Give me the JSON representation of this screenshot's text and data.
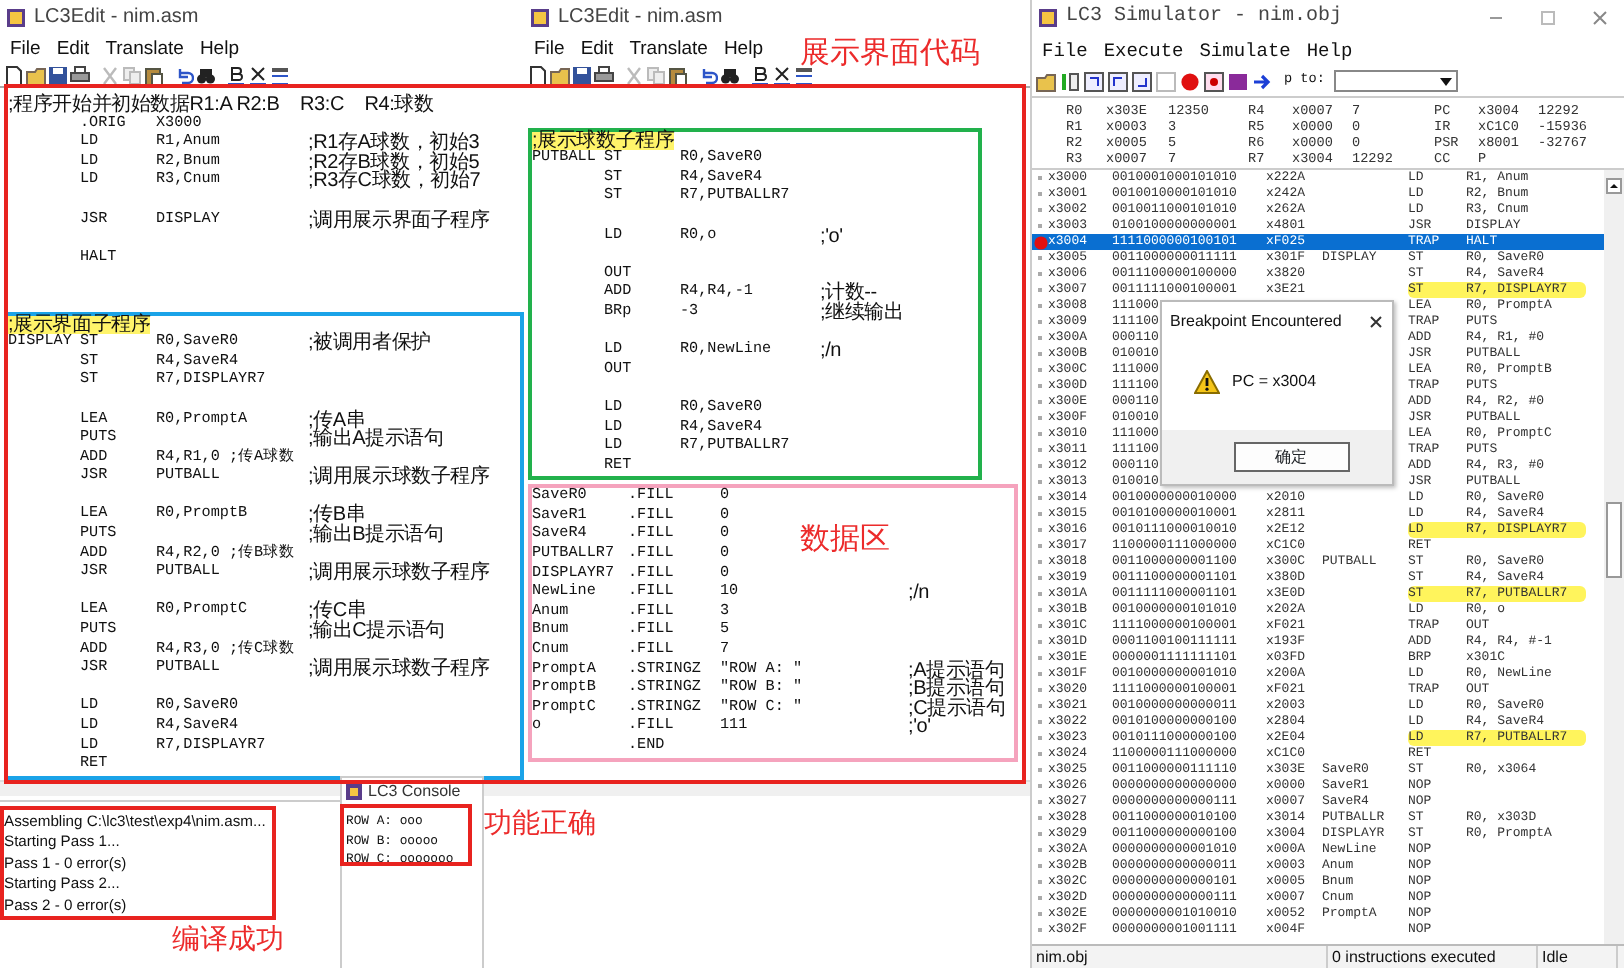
{
  "editors": [
    {
      "title": "LC3Edit - nim.asm",
      "menu": [
        "File",
        "Edit",
        "Translate",
        "Help"
      ],
      "blocks": [
        {
          "lines": [
            {
              "kind": "comment",
              "text": ";程序开始并初始数据R1:A R2:B    R3:C    R4:球数",
              "highlighted": false
            },
            {
              "kind": "code",
              "op": ".ORIG",
              "args": "X3000"
            },
            {
              "kind": "code",
              "op": "LD",
              "args": "R1,Anum",
              "comment": ";R1存A球数，初始3"
            },
            {
              "kind": "code",
              "op": "LD",
              "args": "R2,Bnum",
              "comment": ";R2存B球数，初始5"
            },
            {
              "kind": "code",
              "op": "LD",
              "args": "R3,Cnum",
              "comment": ";R3存C球数，初始7"
            },
            {
              "kind": "blank"
            },
            {
              "kind": "code",
              "op": "JSR",
              "args": "DISPLAY",
              "comment": ";调用展示界面子程序"
            },
            {
              "kind": "blank"
            },
            {
              "kind": "code",
              "op": "HALT"
            },
            {
              "kind": "blank"
            },
            {
              "kind": "blank"
            }
          ]
        },
        {
          "color": "#1aa3e8",
          "lines": [
            {
              "kind": "comment",
              "text": ";展示界面子程序",
              "highlighted": true
            },
            {
              "kind": "code",
              "label": "DISPLAY",
              "op": "ST",
              "args": "R0,SaveR0",
              "comment": ";被调用者保护"
            },
            {
              "kind": "code",
              "op": "ST",
              "args": "R4,SaveR4"
            },
            {
              "kind": "code",
              "op": "ST",
              "args": "R7,DISPLAYR7"
            },
            {
              "kind": "blank"
            },
            {
              "kind": "code",
              "op": "LEA",
              "args": "R0,PromptA",
              "comment": ";传A串"
            },
            {
              "kind": "code",
              "op": "PUTS",
              "comment": ";输出A提示语句"
            },
            {
              "kind": "code",
              "op": "ADD",
              "args": "R4,R1,0 ;传A球数"
            },
            {
              "kind": "code",
              "op": "JSR",
              "args": "PUTBALL",
              "comment": ";调用展示球数子程序"
            },
            {
              "kind": "blank"
            },
            {
              "kind": "code",
              "op": "LEA",
              "args": "R0,PromptB",
              "comment": ";传B串"
            },
            {
              "kind": "code",
              "op": "PUTS",
              "comment": ";输出B提示语句"
            },
            {
              "kind": "code",
              "op": "ADD",
              "args": "R4,R2,0 ;传B球数"
            },
            {
              "kind": "code",
              "op": "JSR",
              "args": "PUTBALL",
              "comment": ";调用展示球数子程序"
            },
            {
              "kind": "blank"
            },
            {
              "kind": "code",
              "op": "LEA",
              "args": "R0,PromptC",
              "comment": ";传C串"
            },
            {
              "kind": "code",
              "op": "PUTS",
              "comment": ";输出C提示语句"
            },
            {
              "kind": "code",
              "op": "ADD",
              "args": "R4,R3,0 ;传C球数"
            },
            {
              "kind": "code",
              "op": "JSR",
              "args": "PUTBALL",
              "comment": ";调用展示球数子程序"
            },
            {
              "kind": "blank"
            },
            {
              "kind": "code",
              "op": "LD",
              "args": "R0,SaveR0"
            },
            {
              "kind": "code",
              "op": "LD",
              "args": "R4,SaveR4"
            },
            {
              "kind": "code",
              "op": "LD",
              "args": "R7,DISPLAYR7"
            },
            {
              "kind": "code",
              "op": "RET"
            }
          ]
        }
      ]
    },
    {
      "title": "LC3Edit - nim.asm",
      "menu": [
        "File",
        "Edit",
        "Translate",
        "Help"
      ],
      "blocks": [
        {
          "lines": [
            {
              "kind": "blank"
            }
          ]
        },
        {
          "color": "#22b14c",
          "lines": [
            {
              "kind": "comment",
              "text": ";展示球数子程序",
              "highlighted": true
            },
            {
              "kind": "code",
              "label": "PUTBALL",
              "op": "ST",
              "args": "R0,SaveR0"
            },
            {
              "kind": "code",
              "op": "ST",
              "args": "R4,SaveR4"
            },
            {
              "kind": "code",
              "op": "ST",
              "args": "R7,PUTBALLR7"
            },
            {
              "kind": "blank"
            },
            {
              "kind": "code",
              "op": "LD",
              "args": "R0,o",
              "comment": ";'o'"
            },
            {
              "kind": "blank"
            },
            {
              "kind": "code",
              "op": "OUT"
            },
            {
              "kind": "code",
              "op": "ADD",
              "args": "R4,R4,-1",
              "comment": ";计数--"
            },
            {
              "kind": "code",
              "op": "BRp",
              "args": "-3",
              "comment": ";继续输出"
            },
            {
              "kind": "blank"
            },
            {
              "kind": "code",
              "op": "LD",
              "args": "R0,NewLine",
              "comment": ";/n"
            },
            {
              "kind": "code",
              "op": "OUT"
            },
            {
              "kind": "blank"
            },
            {
              "kind": "code",
              "op": "LD",
              "args": "R0,SaveR0"
            },
            {
              "kind": "code",
              "op": "LD",
              "args": "R4,SaveR4"
            },
            {
              "kind": "code",
              "op": "LD",
              "args": "R7,PUTBALLR7"
            },
            {
              "kind": "code",
              "op": "RET"
            }
          ]
        },
        {
          "color": "#f5a3bd",
          "lines": [
            {
              "kind": "code",
              "label": "SaveR0",
              "op": ".FILL",
              "args": "0"
            },
            {
              "kind": "code",
              "label": "SaveR1",
              "op": ".FILL",
              "args": "0"
            },
            {
              "kind": "code",
              "label": "SaveR4",
              "op": ".FILL",
              "args": "0"
            },
            {
              "kind": "code",
              "label": "PUTBALLR7",
              "op": ".FILL",
              "args": "0"
            },
            {
              "kind": "code",
              "label": "DISPLAYR7",
              "op": ".FILL",
              "args": "0"
            },
            {
              "kind": "code",
              "label": "NewLine",
              "op": ".FILL",
              "args": "10",
              "comment": ";/n"
            },
            {
              "kind": "code",
              "label": "Anum",
              "op": ".FILL",
              "args": "3"
            },
            {
              "kind": "code",
              "label": "Bnum",
              "op": ".FILL",
              "args": "5"
            },
            {
              "kind": "code",
              "label": "Cnum",
              "op": ".FILL",
              "args": "7"
            },
            {
              "kind": "code",
              "label": "PromptA",
              "op": ".STRINGZ",
              "args": "\"ROW A: \"",
              "comment": ";A提示语句"
            },
            {
              "kind": "code",
              "label": "PromptB",
              "op": ".STRINGZ",
              "args": "\"ROW B: \"",
              "comment": ";B提示语句"
            },
            {
              "kind": "code",
              "label": "PromptC",
              "op": ".STRINGZ",
              "args": "\"ROW C: \"",
              "comment": ";C提示语句"
            },
            {
              "kind": "code",
              "label": "o",
              "op": ".FILL",
              "args": "111",
              "comment": ";'o'"
            },
            {
              "kind": "code",
              "op": ".END"
            }
          ]
        }
      ]
    }
  ],
  "simulator": {
    "title": "LC3 Simulator - nim.obj",
    "menu": [
      "File",
      "Execute",
      "Simulate",
      "Help"
    ],
    "jump_label": "p to:",
    "register_rows": [
      {
        "cells": [
          {
            "name": "R0",
            "hex": "x303E",
            "value": "12350"
          },
          {
            "name": "R4",
            "hex": "x0007",
            "value": "7"
          },
          {
            "name": "PC",
            "hex": "x3004",
            "value": "12292"
          }
        ]
      },
      {
        "cells": [
          {
            "name": "R1",
            "hex": "x0003",
            "value": "3"
          },
          {
            "name": "R5",
            "hex": "x0000",
            "value": "0"
          },
          {
            "name": "IR",
            "hex": "xC1C0",
            "value": "-15936"
          }
        ]
      },
      {
        "cells": [
          {
            "name": "R2",
            "hex": "x0005",
            "value": "5"
          },
          {
            "name": "R6",
            "hex": "x0000",
            "value": "0"
          },
          {
            "name": "PSR",
            "hex": "x8001",
            "value": "-32767"
          }
        ]
      },
      {
        "cells": [
          {
            "name": "R3",
            "hex": "x0007",
            "value": "7"
          },
          {
            "name": "R7",
            "hex": "x3004",
            "value": "12292"
          },
          {
            "name": "CC",
            "hex": "P"
          }
        ]
      }
    ],
    "memory": [
      {
        "addr": "x3000",
        "bin": "0010001000101010",
        "hex": "x222A",
        "op": "LD",
        "operands": "R1, Anum",
        "breakpoint": false,
        "selected": false,
        "highlighted": false
      },
      {
        "addr": "x3001",
        "bin": "0010010000101010",
        "hex": "x242A",
        "op": "LD",
        "operands": "R2, Bnum",
        "breakpoint": false,
        "selected": false,
        "highlighted": false
      },
      {
        "addr": "x3002",
        "bin": "0010011000101010",
        "hex": "x262A",
        "op": "LD",
        "operands": "R3, Cnum",
        "breakpoint": false,
        "selected": false,
        "highlighted": false
      },
      {
        "addr": "x3003",
        "bin": "0100100000000001",
        "hex": "x4801",
        "op": "JSR",
        "operands": "DISPLAY",
        "breakpoint": false,
        "selected": false,
        "highlighted": false
      },
      {
        "addr": "x3004",
        "bin": "1111000000100101",
        "hex": "xF025",
        "op": "TRAP",
        "operands": "HALT",
        "breakpoint": true,
        "selected": true,
        "highlighted": false
      },
      {
        "addr": "x3005",
        "bin": "0011000000011111",
        "hex": "x301F",
        "label": "DISPLAY",
        "op": "ST",
        "operands": "R0, SaveR0",
        "breakpoint": false,
        "selected": false,
        "highlighted": false
      },
      {
        "addr": "x3006",
        "bin": "0011100000100000",
        "hex": "x3820",
        "op": "ST",
        "operands": "R4, SaveR4",
        "breakpoint": false,
        "selected": false,
        "highlighted": false
      },
      {
        "addr": "x3007",
        "bin": "0011111000100001",
        "hex": "x3E21",
        "op": "ST",
        "operands": "R7, DISPLAYR7",
        "breakpoint": false,
        "selected": false,
        "highlighted": true
      },
      {
        "addr": "x3008",
        "bin": "111000",
        "op": "LEA",
        "operands": "R0, PromptA",
        "breakpoint": false,
        "selected": false,
        "highlighted": false
      },
      {
        "addr": "x3009",
        "bin": "111100",
        "op": "TRAP",
        "operands": "PUTS",
        "breakpoint": false,
        "selected": false,
        "highlighted": false
      },
      {
        "addr": "x300A",
        "bin": "000110",
        "op": "ADD",
        "operands": "R4, R1, #0",
        "breakpoint": false,
        "selected": false,
        "highlighted": false
      },
      {
        "addr": "x300B",
        "bin": "010010",
        "op": "JSR",
        "operands": "PUTBALL",
        "breakpoint": false,
        "selected": false,
        "highlighted": false
      },
      {
        "addr": "x300C",
        "bin": "111000",
        "op": "LEA",
        "operands": "R0, PromptB",
        "breakpoint": false,
        "selected": false,
        "highlighted": false
      },
      {
        "addr": "x300D",
        "bin": "111100",
        "op": "TRAP",
        "operands": "PUTS",
        "breakpoint": false,
        "selected": false,
        "highlighted": false
      },
      {
        "addr": "x300E",
        "bin": "000110",
        "op": "ADD",
        "operands": "R4, R2, #0",
        "breakpoint": false,
        "selected": false,
        "highlighted": false
      },
      {
        "addr": "x300F",
        "bin": "010010",
        "op": "JSR",
        "operands": "PUTBALL",
        "breakpoint": false,
        "selected": false,
        "highlighted": false
      },
      {
        "addr": "x3010",
        "bin": "111000",
        "op": "LEA",
        "operands": "R0, PromptC",
        "breakpoint": false,
        "selected": false,
        "highlighted": false
      },
      {
        "addr": "x3011",
        "bin": "111100",
        "op": "TRAP",
        "operands": "PUTS",
        "breakpoint": false,
        "selected": false,
        "highlighted": false
      },
      {
        "addr": "x3012",
        "bin": "000110",
        "op": "ADD",
        "operands": "R4, R3, #0",
        "breakpoint": false,
        "selected": false,
        "highlighted": false
      },
      {
        "addr": "x3013",
        "bin": "010010",
        "op": "JSR",
        "operands": "PUTBALL",
        "breakpoint": false,
        "selected": false,
        "highlighted": false
      },
      {
        "addr": "x3014",
        "bin": "0010000000010000",
        "hex": "x2010",
        "op": "LD",
        "operands": "R0, SaveR0",
        "breakpoint": false,
        "selected": false,
        "highlighted": false
      },
      {
        "addr": "x3015",
        "bin": "0010100000010001",
        "hex": "x2811",
        "op": "LD",
        "operands": "R4, SaveR4",
        "breakpoint": false,
        "selected": false,
        "highlighted": false
      },
      {
        "addr": "x3016",
        "bin": "0010111000010010",
        "hex": "x2E12",
        "op": "LD",
        "operands": "R7, DISPLAYR7",
        "breakpoint": false,
        "selected": false,
        "highlighted": true
      },
      {
        "addr": "x3017",
        "bin": "1100000111000000",
        "hex": "xC1C0",
        "op": "RET",
        "breakpoint": false,
        "selected": false,
        "highlighted": false
      },
      {
        "addr": "x3018",
        "bin": "0011000000001100",
        "hex": "x300C",
        "label": "PUTBALL",
        "op": "ST",
        "operands": "R0, SaveR0",
        "breakpoint": false,
        "selected": false,
        "highlighted": false
      },
      {
        "addr": "x3019",
        "bin": "0011100000001101",
        "hex": "x380D",
        "op": "ST",
        "operands": "R4, SaveR4",
        "breakpoint": false,
        "selected": false,
        "highlighted": false
      },
      {
        "addr": "x301A",
        "bin": "0011111000001101",
        "hex": "x3E0D",
        "op": "ST",
        "operands": "R7, PUTBALLR7",
        "breakpoint": false,
        "selected": false,
        "highlighted": true
      },
      {
        "addr": "x301B",
        "bin": "0010000000101010",
        "hex": "x202A",
        "op": "LD",
        "operands": "R0, o",
        "breakpoint": false,
        "selected": false,
        "highlighted": false
      },
      {
        "addr": "x301C",
        "bin": "1111000000100001",
        "hex": "xF021",
        "op": "TRAP",
        "operands": "OUT",
        "breakpoint": false,
        "selected": false,
        "highlighted": false
      },
      {
        "addr": "x301D",
        "bin": "0001100100111111",
        "hex": "x193F",
        "op": "ADD",
        "operands": "R4, R4, #-1",
        "breakpoint": false,
        "selected": false,
        "highlighted": false
      },
      {
        "addr": "x301E",
        "bin": "0000001111111101",
        "hex": "x03FD",
        "op": "BRP",
        "operands": "x301C",
        "breakpoint": false,
        "selected": false,
        "highlighted": false
      },
      {
        "addr": "x301F",
        "bin": "0010000000001010",
        "hex": "x200A",
        "op": "LD",
        "operands": "R0, NewLine",
        "breakpoint": false,
        "selected": false,
        "highlighted": false
      },
      {
        "addr": "x3020",
        "bin": "1111000000100001",
        "hex": "xF021",
        "op": "TRAP",
        "operands": "OUT",
        "breakpoint": false,
        "selected": false,
        "highlighted": false
      },
      {
        "addr": "x3021",
        "bin": "0010000000000011",
        "hex": "x2003",
        "op": "LD",
        "operands": "R0, SaveR0",
        "breakpoint": false,
        "selected": false,
        "highlighted": false
      },
      {
        "addr": "x3022",
        "bin": "0010100000000100",
        "hex": "x2804",
        "op": "LD",
        "operands": "R4, SaveR4",
        "breakpoint": false,
        "selected": false,
        "highlighted": false
      },
      {
        "addr": "x3023",
        "bin": "0010111000000100",
        "hex": "x2E04",
        "op": "LD",
        "operands": "R7, PUTBALLR7",
        "breakpoint": false,
        "selected": false,
        "highlighted": true
      },
      {
        "addr": "x3024",
        "bin": "1100000111000000",
        "hex": "xC1C0",
        "op": "RET",
        "breakpoint": false,
        "selected": false,
        "highlighted": false
      },
      {
        "addr": "x3025",
        "bin": "0011000000111110",
        "hex": "x303E",
        "label": "SaveR0",
        "op": "ST",
        "operands": "R0, x3064",
        "breakpoint": false,
        "selected": false,
        "highlighted": false
      },
      {
        "addr": "x3026",
        "bin": "0000000000000000",
        "hex": "x0000",
        "label": "SaveR1",
        "op": "NOP",
        "breakpoint": false,
        "selected": false,
        "highlighted": false
      },
      {
        "addr": "x3027",
        "bin": "0000000000000111",
        "hex": "x0007",
        "label": "SaveR4",
        "op": "NOP",
        "breakpoint": false,
        "selected": false,
        "highlighted": false
      },
      {
        "addr": "x3028",
        "bin": "0011000000010100",
        "hex": "x3014",
        "label": "PUTBALLR",
        "op": "ST",
        "operands": "R0, x303D",
        "breakpoint": false,
        "selected": false,
        "highlighted": false
      },
      {
        "addr": "x3029",
        "bin": "0011000000000100",
        "hex": "x3004",
        "label": "DISPLAYR",
        "op": "ST",
        "operands": "R0, PromptA",
        "breakpoint": false,
        "selected": false,
        "highlighted": false
      },
      {
        "addr": "x302A",
        "bin": "0000000000001010",
        "hex": "x000A",
        "label": "NewLine",
        "op": "NOP",
        "breakpoint": false,
        "selected": false,
        "highlighted": false
      },
      {
        "addr": "x302B",
        "bin": "0000000000000011",
        "hex": "x0003",
        "label": "Anum",
        "op": "NOP",
        "breakpoint": false,
        "selected": false,
        "highlighted": false
      },
      {
        "addr": "x302C",
        "bin": "0000000000000101",
        "hex": "x0005",
        "label": "Bnum",
        "op": "NOP",
        "breakpoint": false,
        "selected": false,
        "highlighted": false
      },
      {
        "addr": "x302D",
        "bin": "0000000000000111",
        "hex": "x0007",
        "label": "Cnum",
        "op": "NOP",
        "breakpoint": false,
        "selected": false,
        "highlighted": false
      },
      {
        "addr": "x302E",
        "bin": "0000000001010010",
        "hex": "x0052",
        "label": "PromptA",
        "op": "NOP",
        "breakpoint": false,
        "selected": false,
        "highlighted": false
      },
      {
        "addr": "x302F",
        "bin": "0000000001001111",
        "hex": "x004F",
        "op": "NOP",
        "breakpoint": false,
        "selected": false,
        "highlighted": false
      }
    ],
    "status": [
      "nim.obj",
      "0 instructions executed",
      "Idle"
    ],
    "dialog": {
      "title": "Breakpoint Encountered",
      "message": "PC = x3004",
      "button": "确定"
    }
  },
  "output": {
    "lines": [
      "Assembling C:\\lc3\\test\\exp4\\nim.asm...",
      "Starting Pass 1...",
      "Pass 1 - 0 error(s)",
      "Starting Pass 2...",
      "Pass 2 - 0 error(s)"
    ]
  },
  "console": {
    "title": "LC3 Console",
    "lines": [
      "ROW A: ooo",
      "ROW B: ooooo",
      "ROW C: ooooooo"
    ]
  },
  "annotations": [
    {
      "kind": "frame"
    },
    {
      "kind": "frame"
    },
    {
      "kind": "frame"
    },
    {
      "kind": "label",
      "text": "展示界面代码"
    },
    {
      "kind": "label",
      "text": "数据区"
    },
    {
      "kind": "label",
      "text": "编译成功"
    },
    {
      "kind": "label",
      "text": "功能正确"
    }
  ]
}
